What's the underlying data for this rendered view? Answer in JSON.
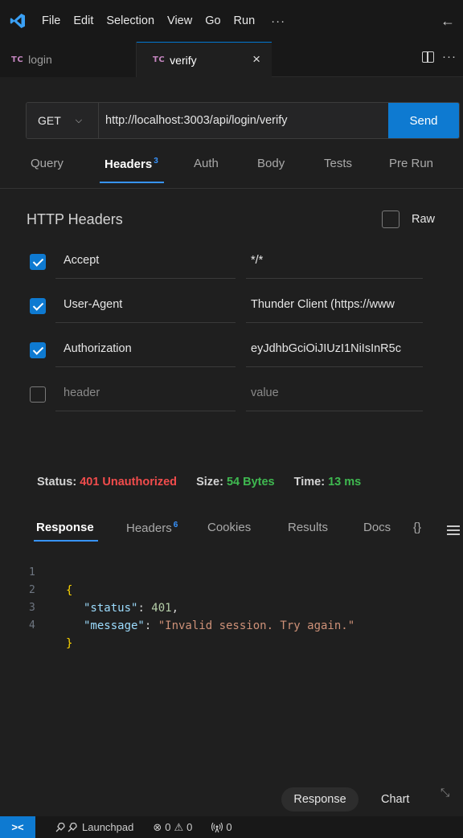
{
  "menubar": {
    "logo_icon": "vscode-logo-icon",
    "items": [
      "File",
      "Edit",
      "Selection",
      "View",
      "Go",
      "Run"
    ],
    "more": "···",
    "back": "←"
  },
  "tabs": [
    {
      "badge": "TC",
      "label": "login"
    },
    {
      "badge": "TC",
      "label": "verify",
      "close": "×"
    }
  ],
  "tabbar": {
    "more": "···"
  },
  "request": {
    "method": "GET",
    "method_chevron": "⌵",
    "url": "http://localhost:3003/api/login/verify",
    "send_label": "Send"
  },
  "subtabs": {
    "query": "Query",
    "headers": "Headers",
    "headers_count": "3",
    "auth": "Auth",
    "body": "Body",
    "tests": "Tests",
    "prerun": "Pre Run"
  },
  "headers_section": {
    "title": "HTTP Headers",
    "raw_label": "Raw",
    "rows": [
      {
        "key": "Accept",
        "value": "*/*",
        "checked": true
      },
      {
        "key": "User-Agent",
        "value": "Thunder Client (https://www",
        "checked": true
      },
      {
        "key": "Authorization",
        "value": "eyJdhbGciOiJIUzI1NiIsInR5c",
        "checked": true
      },
      {
        "key": "header",
        "value": "value",
        "checked": false
      }
    ]
  },
  "status": {
    "status_label": "Status:",
    "status_value": "401 Unauthorized",
    "size_label": "Size:",
    "size_value": "54 Bytes",
    "time_label": "Time:",
    "time_value": "13 ms"
  },
  "response_tabs": {
    "response": "Response",
    "headers": "Headers",
    "headers_count": "6",
    "cookies": "Cookies",
    "results": "Results",
    "docs": "Docs",
    "braces": "{}"
  },
  "code_lines": {
    "l1": "1",
    "l2": "2",
    "l3": "3",
    "l4": "4",
    "open": "{",
    "status_key": "\"status\"",
    "status_val": "401",
    "message_key": "\"message\"",
    "message_val": "\"Invalid session. Try again.\"",
    "close": "}",
    "colon": ": ",
    "comma": ","
  },
  "bottom_tabs": {
    "response": "Response",
    "chart": "Chart"
  },
  "statusbar": {
    "remote": "><",
    "launchpad": "Launchpad",
    "errors": "0",
    "warnings": "0",
    "ports": "0"
  },
  "colors": {
    "accent": "#0e7ad1",
    "error": "#f14c4c",
    "success": "#3fb950",
    "tc_badge": "#c586c0"
  }
}
